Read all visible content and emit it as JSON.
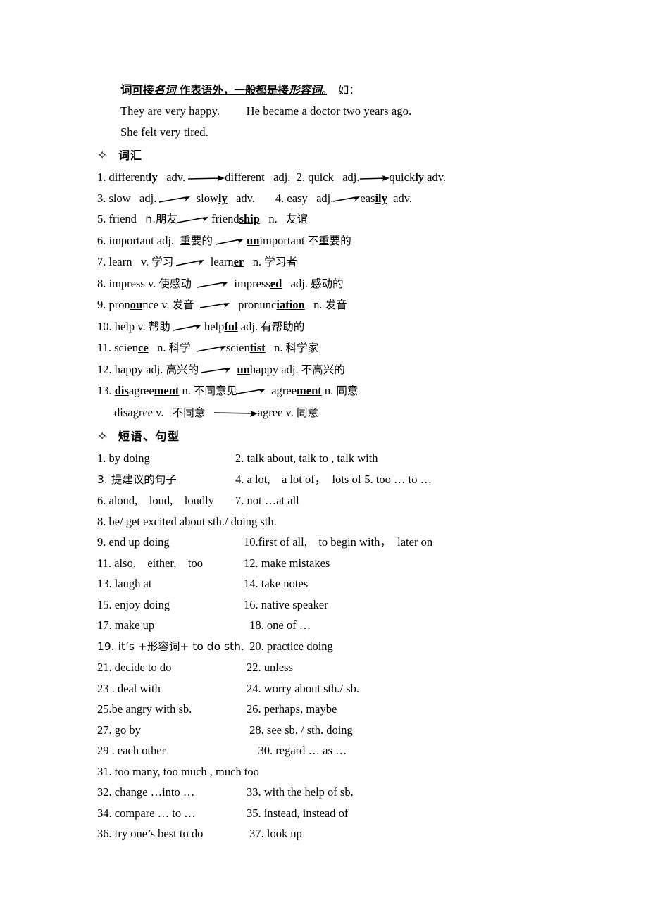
{
  "document": {
    "intro": {
      "line1": {
        "lead": "词",
        "underlined_part_a": "可接",
        "underlined_emph_a": "名词",
        "underlined_mid": " 作表语外，一般都是接",
        "underlined_emph_b": "形容词",
        "underlined_tail": "。",
        "suffix": "　如："
      },
      "examples": [
        {
          "prefix": "They ",
          "underlined": "are very happy",
          "suffix": ".",
          "prefix2": "　　 He became ",
          "underlined2": "a doctor ",
          "suffix2": "two years ago."
        },
        {
          "prefix": "She ",
          "underlined": "felt very tired.",
          "suffix": ""
        }
      ]
    },
    "sections": [
      {
        "bullet": "✧",
        "title": "词汇",
        "name": "vocabulary",
        "entries": [
          {
            "num": "1.",
            "left": "differently",
            "left_bold": "ly",
            "left_pos": "adv.",
            "arrow": "long",
            "right": "different",
            "right_pos": "adj.",
            "second_num": "2.",
            "second_left": "quick",
            "second_pos": "adj.",
            "second_right": "quickly",
            "second_right_bold": "ly",
            "second_right_pos": "adv."
          },
          {
            "num": "3.",
            "left": "slow",
            "left_pos": "adj.",
            "arrow": "short",
            "right": "slowly",
            "right_bold": "ly",
            "right_pos": "adv.",
            "second_num": "4.",
            "second_left": "easy",
            "second_pos": "adj.",
            "second_right": "easily",
            "second_right_bold": "ily",
            "second_right_pos": "adv."
          },
          {
            "num": "5.",
            "left": "friend",
            "left_pos": "n.朋友",
            "arrow": "short",
            "right": "friendship",
            "right_bold": "ship",
            "right_pos": "n.",
            "gloss": "友谊"
          },
          {
            "num": "6.",
            "left": "important adj.",
            "gloss_left": "重要的",
            "arrow": "short",
            "right": "unimportant",
            "right_bold_pre": "un",
            "gloss": "不重要的"
          },
          {
            "num": "7.",
            "left": "learn",
            "left_pos": "v.",
            "gloss_left": "学习",
            "arrow": "short",
            "right": "learner",
            "right_bold": "er",
            "right_pos": "n.",
            "gloss": "学习者"
          },
          {
            "num": "8.",
            "left": "impress v.",
            "gloss_left": "使感动",
            "arrow": "short",
            "right": "impressed",
            "right_bold": "ed",
            "right_pos": "adj.",
            "gloss": "感动的"
          },
          {
            "num": "9.",
            "left": "pronounce v.",
            "left_bold_mid": "ou",
            "gloss_left": "发音",
            "arrow": "short",
            "right": "pronunciation",
            "right_bold": "iation",
            "right_pos": "n.",
            "gloss": "发音"
          },
          {
            "num": "10.",
            "left": "help v.",
            "gloss_left": "帮助",
            "arrow": "short",
            "right": "helpful",
            "right_bold": "ful",
            "right_pos": "adj.",
            "gloss": "有帮助的"
          },
          {
            "num": "11.",
            "left": "science",
            "left_bold": "ce",
            "left_pos": "n.",
            "gloss_left": "科学",
            "arrow": "short",
            "right": "scientist",
            "right_bold": "tist",
            "right_pos": "n.",
            "gloss": "科学家"
          },
          {
            "num": "12.",
            "left": "happy adj.",
            "gloss_left": "高兴的",
            "arrow": "short",
            "right": "unhappy adj.",
            "right_bold_pre": "un",
            "gloss": "不高兴的"
          },
          {
            "num": "13.",
            "left": "disagreement",
            "left_bold_pre": "dis",
            "left_bold_suf": "ment",
            "left_pos": "n.",
            "gloss_left": "不同意见",
            "arrow": "short",
            "right": "agreement",
            "right_bold": "ment",
            "right_pos": "n.",
            "gloss": "同意"
          },
          {
            "num": "",
            "left": "disagree v.",
            "gloss_left": "不同意",
            "arrow": "long",
            "right": "agree v.",
            "gloss": "同意",
            "indented": true
          }
        ]
      },
      {
        "bullet": "✧",
        "title": "短语、句型",
        "name": "phrases-sentence-patterns",
        "items": [
          {
            "left": "1. by doing",
            "right": "2. talk about, talk to , talk with"
          },
          {
            "left": "3. 提建议的句子",
            "right": "4. a lot,　a lot of，　lots of 5. too … to …"
          },
          {
            "left": "6. aloud,　loud,　loudly",
            "right": "7. not …at all"
          },
          {
            "left": "8. be/ get excited about sth./ doing sth.",
            "right": ""
          },
          {
            "left": "9. end up doing",
            "right": "10.first of all,　to begin with，　later on"
          },
          {
            "left": "11. also,　either,　too",
            "right": "12. make mistakes"
          },
          {
            "left": "13. laugh at",
            "right": "14. take notes"
          },
          {
            "left": "15. enjoy doing",
            "right": "16. native speaker"
          },
          {
            "left": "17. make up",
            "right": " 18. one of …"
          },
          {
            "left": "19. it’s +形容词+ to do sth.",
            "right": " 20. practice doing"
          },
          {
            "left": "21. decide to do",
            "right": "22. unless"
          },
          {
            "left": "23 . deal with",
            "right": "24. worry about sth./ sb."
          },
          {
            "left": "25.be angry with sb.",
            "right": "26. perhaps, maybe"
          },
          {
            "left": "27. go by",
            "right": " 28. see sb. / sth. doing"
          },
          {
            "left": "29 . each other",
            "right": "　30. regard … as …"
          },
          {
            "left": "31. too many, too much , much too",
            "right": ""
          },
          {
            "left": "32. change …into …",
            "right": "33. with the help of sb."
          },
          {
            "left": "34. compare … to …",
            "right": "35. instead, instead of"
          },
          {
            "left": "36. try one’s best to do",
            "right": " 37. look up"
          }
        ]
      }
    ]
  }
}
